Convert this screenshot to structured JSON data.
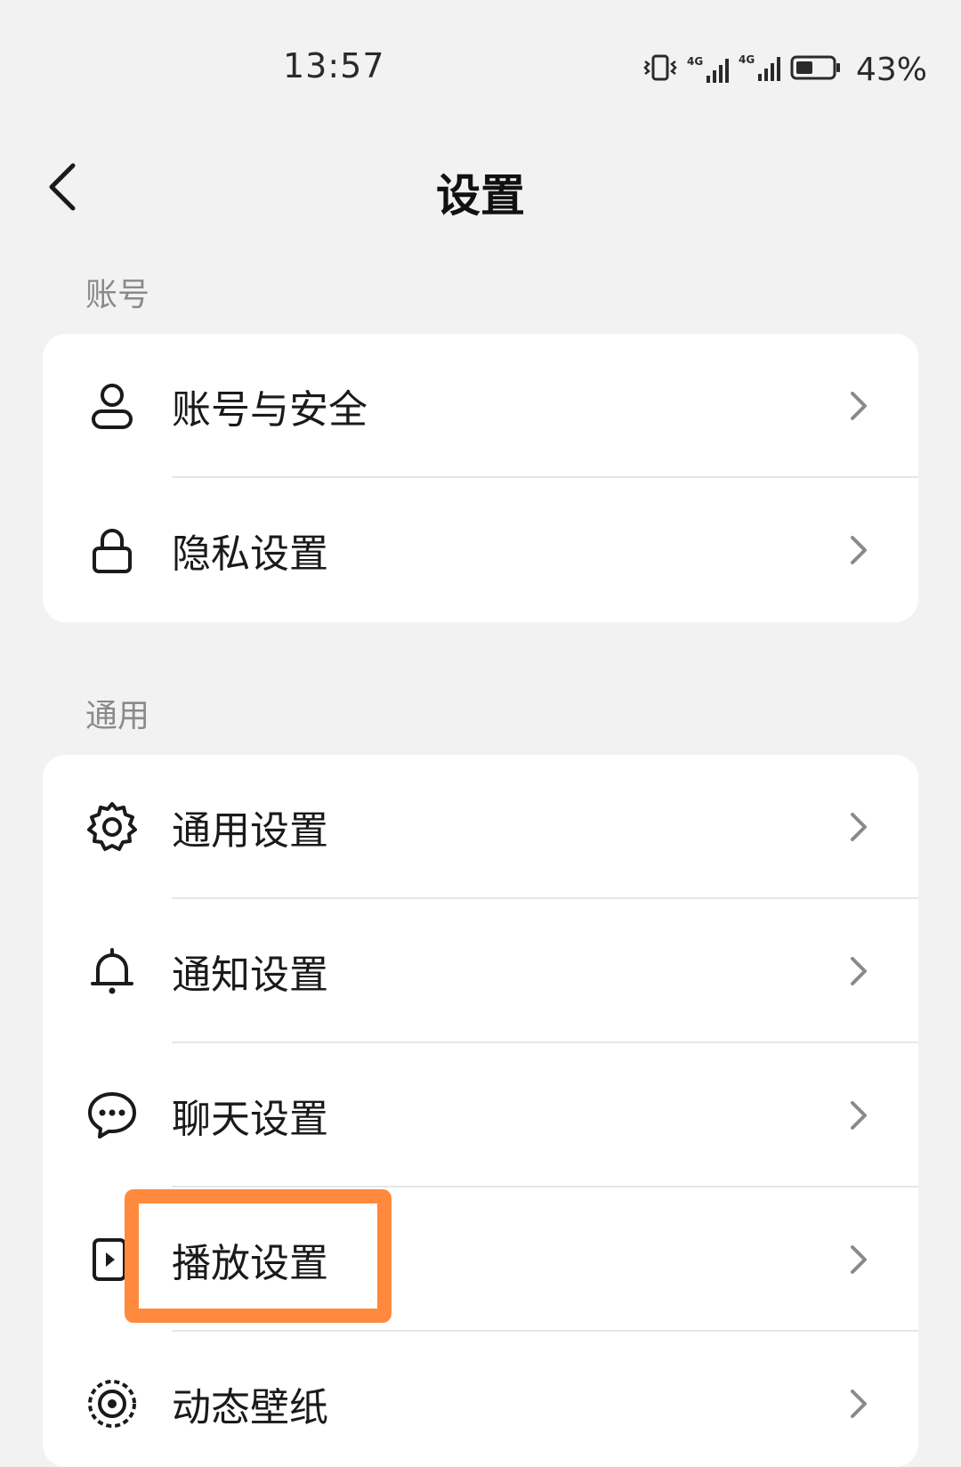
{
  "status_bar": {
    "time": "13:57",
    "battery_percent": "43%",
    "network_label_1": "4G",
    "network_label_2": "4G",
    "icons": [
      "vibrate-icon",
      "signal-icon",
      "signal-icon",
      "battery-icon"
    ]
  },
  "header": {
    "title": "设置",
    "back_icon": "back-arrow-icon"
  },
  "sections": [
    {
      "label": "账号",
      "items": [
        {
          "label": "账号与安全",
          "icon": "user-icon"
        },
        {
          "label": "隐私设置",
          "icon": "lock-icon"
        }
      ]
    },
    {
      "label": "通用",
      "items": [
        {
          "label": "通用设置",
          "icon": "gear-icon"
        },
        {
          "label": "通知设置",
          "icon": "bell-icon"
        },
        {
          "label": "聊天设置",
          "icon": "chat-bubble-icon"
        },
        {
          "label": "播放设置",
          "icon": "play-icon"
        },
        {
          "label": "动态壁纸",
          "icon": "wallpaper-icon"
        }
      ]
    }
  ],
  "highlight": {
    "target": "播放设置",
    "color": "#ff8a3d"
  }
}
